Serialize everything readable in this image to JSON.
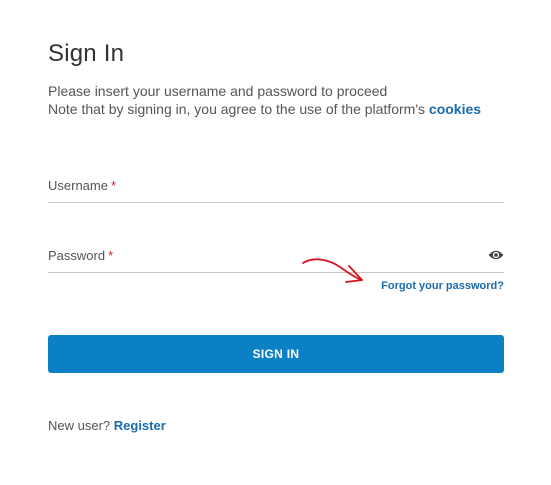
{
  "title": "Sign In",
  "subtitle": {
    "line1": "Please insert your username and password to proceed",
    "line2_prefix": "Note that by signing in, you agree to the use of the platform's",
    "cookies_link": "cookies"
  },
  "form": {
    "username_label": "Username",
    "password_label": "Password",
    "required_mark": "*",
    "password_toggle_icon": "eye-icon",
    "forgot_password_link": "Forgot your password?",
    "sign_in_button": "SIGN IN"
  },
  "footer": {
    "new_user_text": "New user?",
    "register_link": "Register"
  },
  "colors": {
    "accent": "#0b80c4",
    "link": "#1a6bae",
    "required": "#c62828",
    "annotation_arrow": "#d8141e"
  }
}
